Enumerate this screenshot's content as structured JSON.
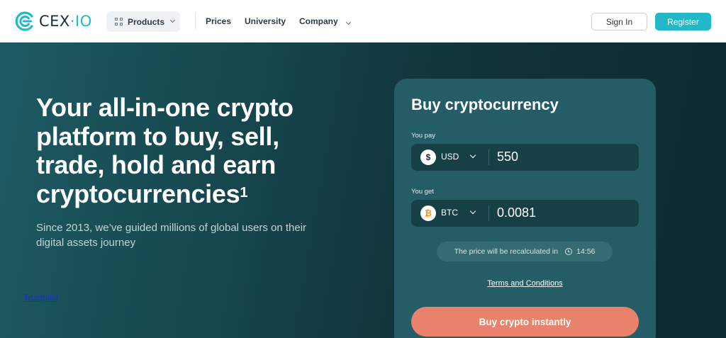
{
  "brand": {
    "name_main": "CEX",
    "name_accent": "·IO",
    "accent_color": "#22b8c7"
  },
  "nav": {
    "products_label": "Products",
    "prices_label": "Prices",
    "university_label": "University",
    "company_label": "Company"
  },
  "auth": {
    "signin_label": "Sign In",
    "register_label": "Register"
  },
  "hero": {
    "title": "Your all-in-one crypto platform to buy, sell, trade, hold and earn cryptocurrencies",
    "title_footnote": "1",
    "subtitle": "Since 2013, we’ve guided millions of global users on their digital assets journey",
    "trustpilot_label": "Trustpilot"
  },
  "buy_card": {
    "title": "Buy cryptocurrency",
    "you_pay_label": "You pay",
    "pay_currency": "USD",
    "pay_icon": "$",
    "pay_amount": "550",
    "you_get_label": "You get",
    "get_currency": "BTC",
    "get_icon": "₿",
    "get_amount": "0.0081",
    "recalc_text": "The price will be recalculated in",
    "recalc_timer": "14:56",
    "terms_label": "Terms and Conditions",
    "buy_button_label": "Buy crypto instantly",
    "buy_button_color": "#e9826a"
  }
}
